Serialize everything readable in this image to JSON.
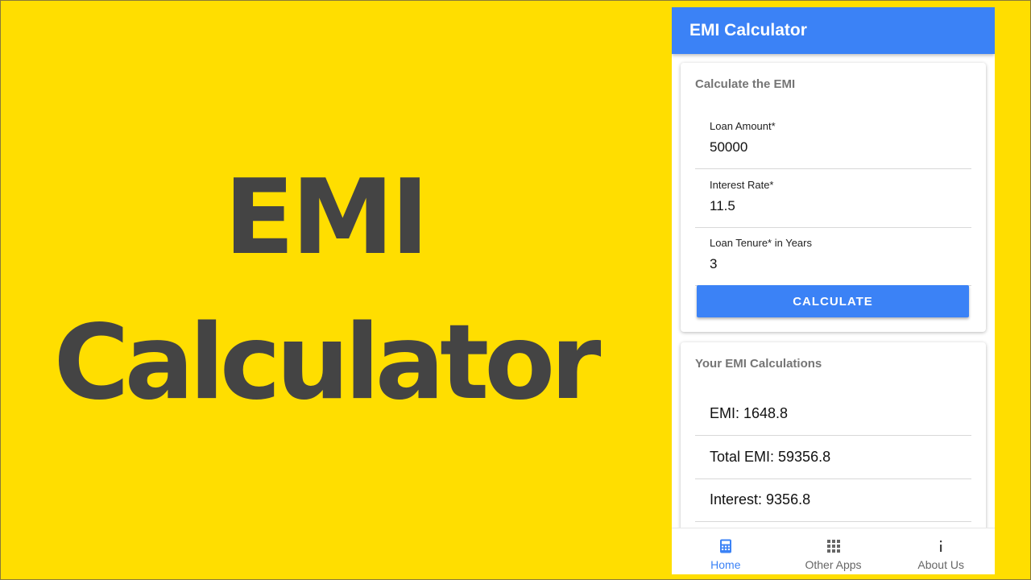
{
  "promo": {
    "line1": "EMI",
    "line2": "Calculator"
  },
  "app": {
    "title": "EMI Calculator",
    "accent": "#3B82F6",
    "background": "#FFDE00"
  },
  "form_card": {
    "title": "Calculate the EMI",
    "fields": [
      {
        "label": "Loan Amount*",
        "value": "50000"
      },
      {
        "label": "Interest Rate*",
        "value": "11.5"
      },
      {
        "label": "Loan Tenure* in Years",
        "value": "3"
      }
    ],
    "button_label": "CALCULATE"
  },
  "results_card": {
    "title": "Your EMI Calculations",
    "rows": [
      {
        "text": "EMI: 1648.8"
      },
      {
        "text": "Total EMI: 59356.8"
      },
      {
        "text": "Interest: 9356.8"
      }
    ]
  },
  "bottom_nav": {
    "items": [
      {
        "label": "Home",
        "icon": "calculator-icon",
        "active": true
      },
      {
        "label": "Other Apps",
        "icon": "grid-icon",
        "active": false
      },
      {
        "label": "About Us",
        "icon": "info-icon",
        "active": false
      }
    ]
  }
}
